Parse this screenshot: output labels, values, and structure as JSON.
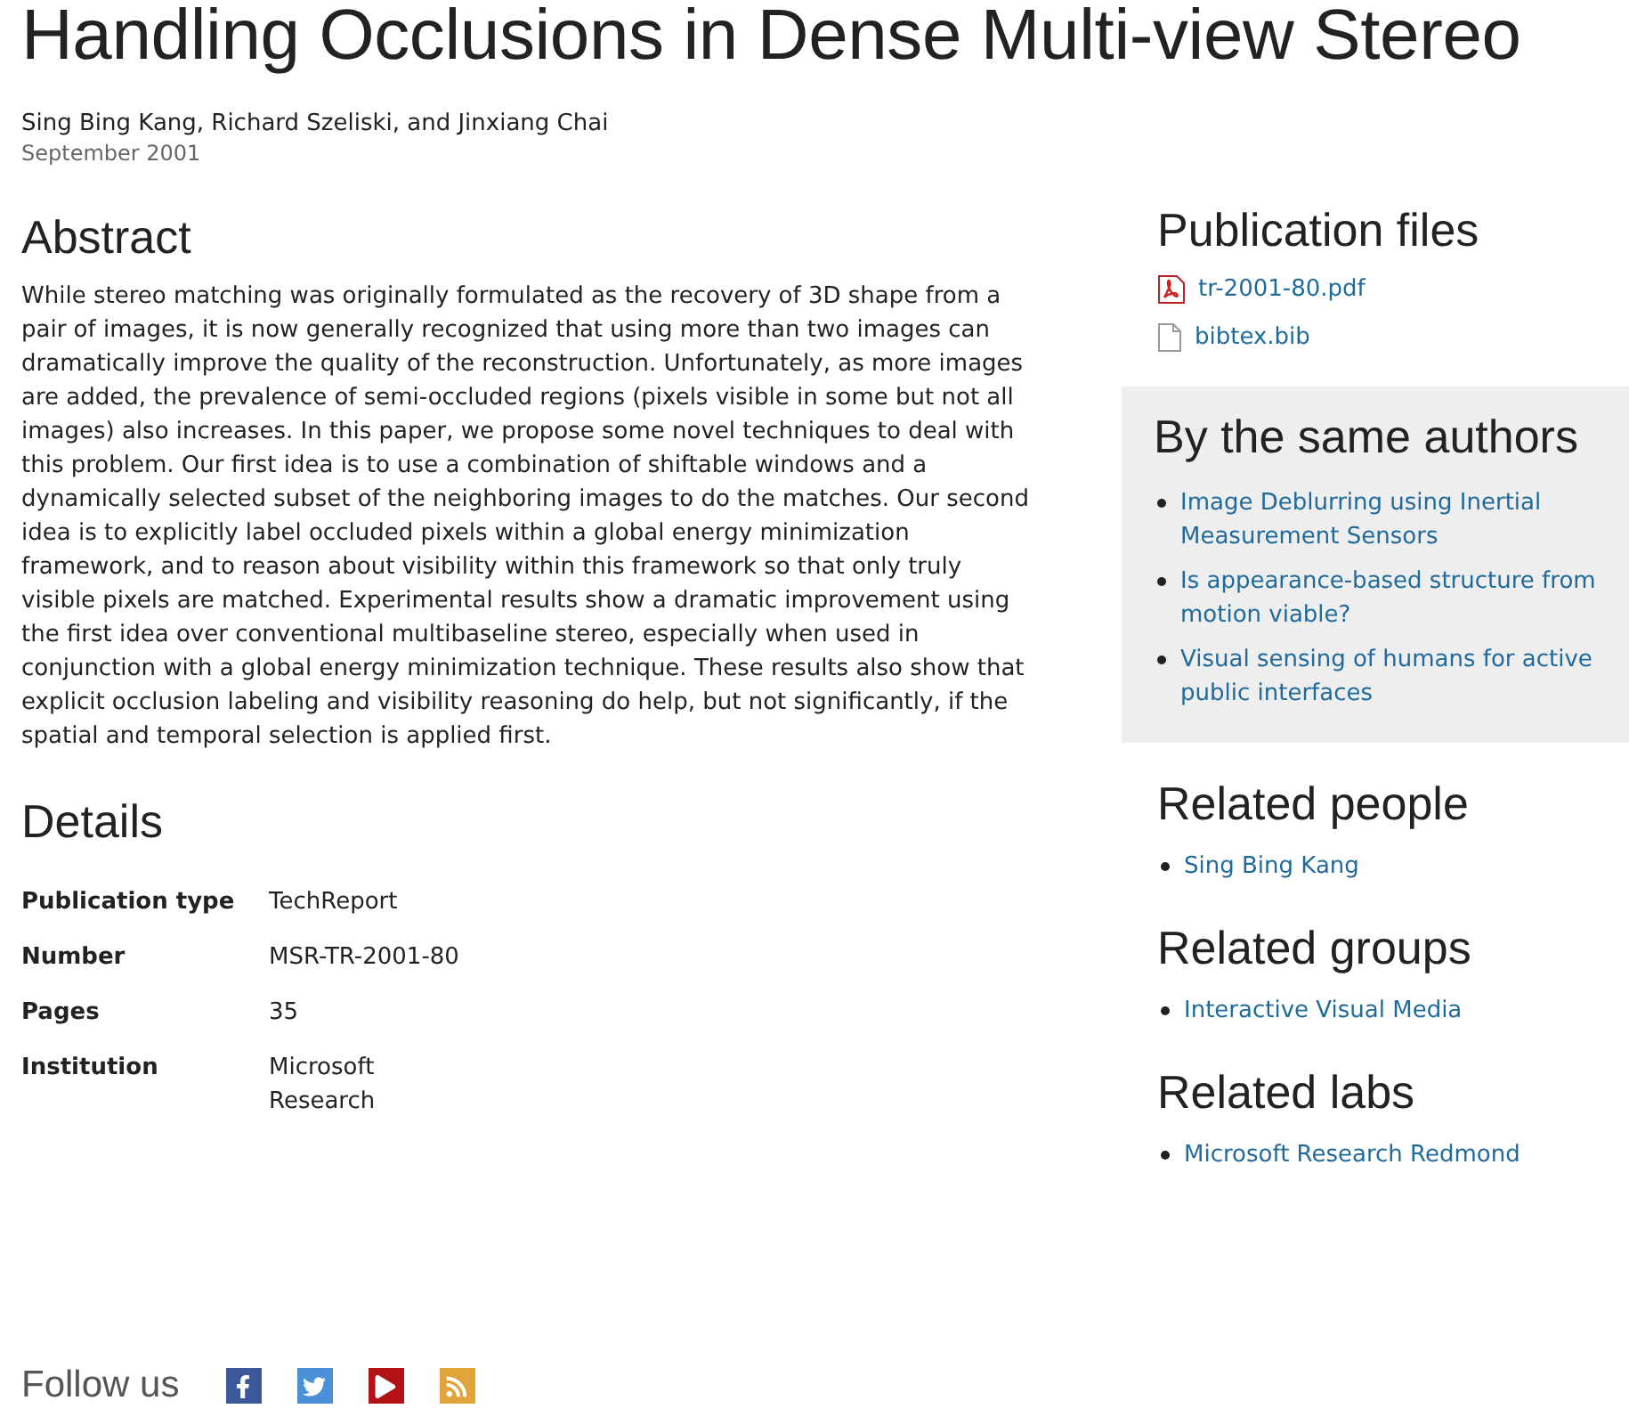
{
  "title": "Handling Occlusions in Dense Multi-view Stereo",
  "authors": "Sing Bing Kang, Richard Szeliski, and Jinxiang Chai",
  "date": "September 2001",
  "abstract": {
    "heading": "Abstract",
    "text": "While stereo matching was originally formulated as the recovery of 3D shape from a pair of images, it is now generally recognized that using more than two images can dramatically improve the quality of the reconstruction. Unfortunately, as more images are added, the prevalence of semi-occluded regions (pixels visible in some but not all images) also increases. In this paper, we propose some novel techniques to deal with this problem. Our first idea is to use a combination of shiftable windows and a dynamically selected subset of the neighboring images to do the matches. Our second idea is to explicitly label occluded pixels within a global energy minimization framework, and to reason about visibility within this framework so that only truly visible pixels are matched. Experimental results show a dramatic improvement using the first idea over conventional multibaseline stereo, especially when used in conjunction with a global energy minimization technique. These results also show that explicit occlusion labeling and visibility reasoning do help, but not significantly, if the spatial and temporal selection is applied first."
  },
  "details": {
    "heading": "Details",
    "rows": [
      {
        "label": "Publication type",
        "value": "TechReport"
      },
      {
        "label": "Number",
        "value": "MSR-TR-2001-80"
      },
      {
        "label": "Pages",
        "value": "35"
      },
      {
        "label": "Institution",
        "value": "Microsoft Research"
      }
    ]
  },
  "publication_files": {
    "heading": "Publication files",
    "files": [
      {
        "kind": "pdf",
        "name": "tr-2001-80.pdf"
      },
      {
        "kind": "file",
        "name": "bibtex.bib"
      }
    ]
  },
  "same_authors": {
    "heading": "By the same authors",
    "items": [
      "Image Deblurring using Inertial Measurement Sensors",
      "Is appearance-based structure from motion viable?",
      "Visual sensing of humans for active public interfaces"
    ]
  },
  "related": [
    {
      "heading": "Related people",
      "items": [
        "Sing Bing Kang"
      ]
    },
    {
      "heading": "Related groups",
      "items": [
        "Interactive Visual Media"
      ]
    },
    {
      "heading": "Related labs",
      "items": [
        "Microsoft Research Redmond"
      ]
    }
  ],
  "follow": {
    "label": "Follow us",
    "links": [
      {
        "kind": "facebook"
      },
      {
        "kind": "twitter"
      },
      {
        "kind": "youtube"
      },
      {
        "kind": "rss"
      }
    ]
  }
}
